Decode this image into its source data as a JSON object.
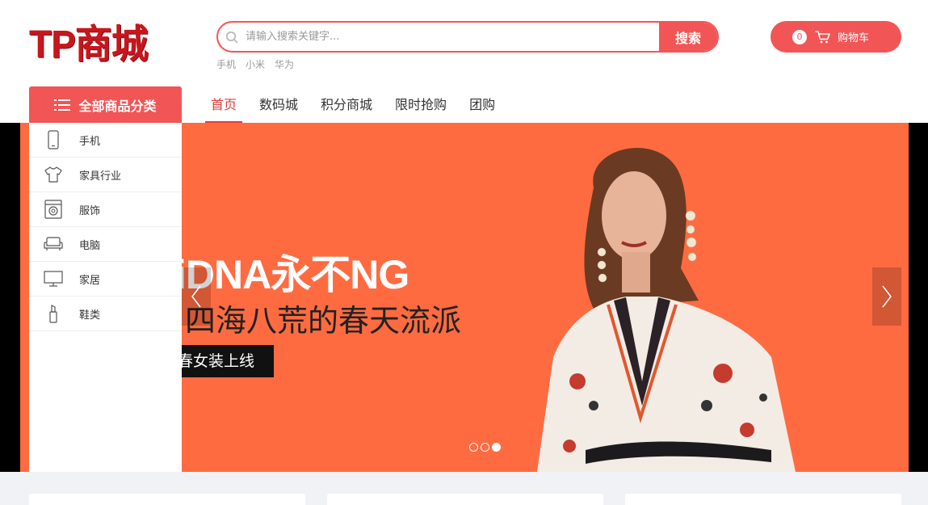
{
  "header": {
    "logo_text": "TP商城",
    "search": {
      "placeholder": "请输入搜索关键字...",
      "button_label": "搜索"
    },
    "hot_words": [
      "手机",
      "小米",
      "华为"
    ],
    "cart": {
      "count": "0",
      "label": "购物车"
    }
  },
  "nav": {
    "category_title": "全部商品分类",
    "items": [
      {
        "label": "首页",
        "active": true
      },
      {
        "label": "数码城"
      },
      {
        "label": "积分商城"
      },
      {
        "label": "限时抢购"
      },
      {
        "label": "团购"
      }
    ]
  },
  "categories": [
    {
      "label": "手机",
      "icon": "phone-icon"
    },
    {
      "label": "家具行业",
      "icon": "tshirt-icon"
    },
    {
      "label": "服饰",
      "icon": "washing-machine-icon"
    },
    {
      "label": "电脑",
      "icon": "sofa-icon"
    },
    {
      "label": "家居",
      "icon": "monitor-icon"
    },
    {
      "label": "鞋类",
      "icon": "lipstick-icon"
    }
  ],
  "banner": {
    "line1": "iDNA永不NG",
    "line2": "四海八荒的春天流派",
    "tag": "春女装上线",
    "slides_total": 3,
    "active_slide": 3
  },
  "colors": {
    "accent": "#f25555",
    "brand_red": "#c8161d",
    "banner_bg": "#ff6b41",
    "nav_active": "#e4393c"
  }
}
